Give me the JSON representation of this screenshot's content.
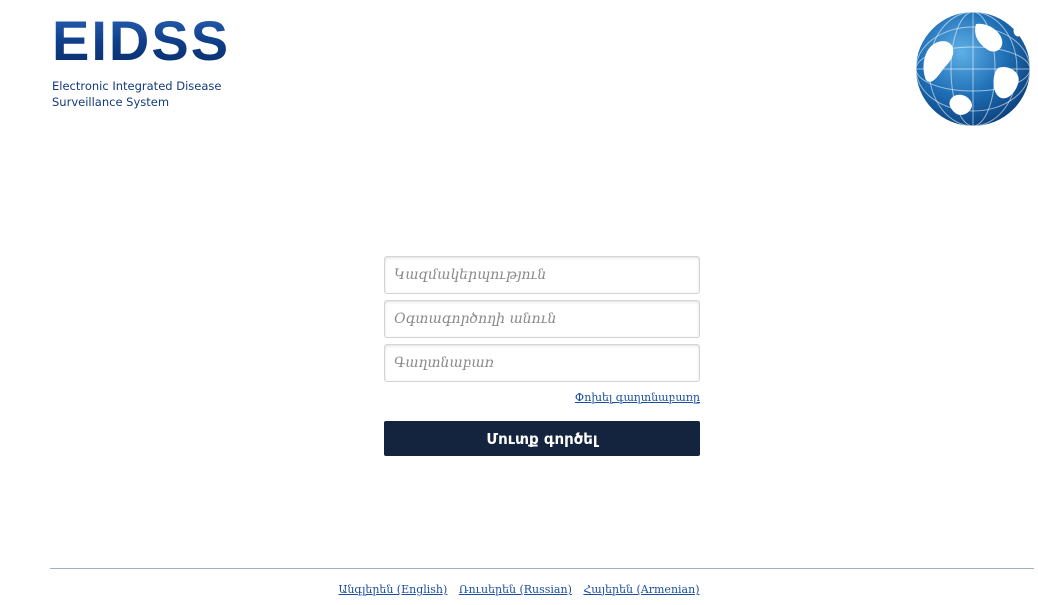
{
  "header": {
    "logo_text": "EIDSS",
    "logo_subtitle_line1": "Electronic Integrated Disease",
    "logo_subtitle_line2": "Surveillance System",
    "globe_icon": "globe-icon",
    "brand_color": "#0e3c86"
  },
  "login": {
    "organization_placeholder": "Կազմակերպություն",
    "username_placeholder": "Օգտագործողի անուն",
    "password_placeholder": "Գաղտնաբառ",
    "forgot_password_label": "Փոխել գաղտնաբառը",
    "submit_label": "Մուտք գործել",
    "button_color": "#14243f"
  },
  "footer": {
    "languages": [
      "Անգլերեն (English)",
      "Ռուսերեն (Russian)",
      "Հայերեն (Armenian)"
    ]
  }
}
